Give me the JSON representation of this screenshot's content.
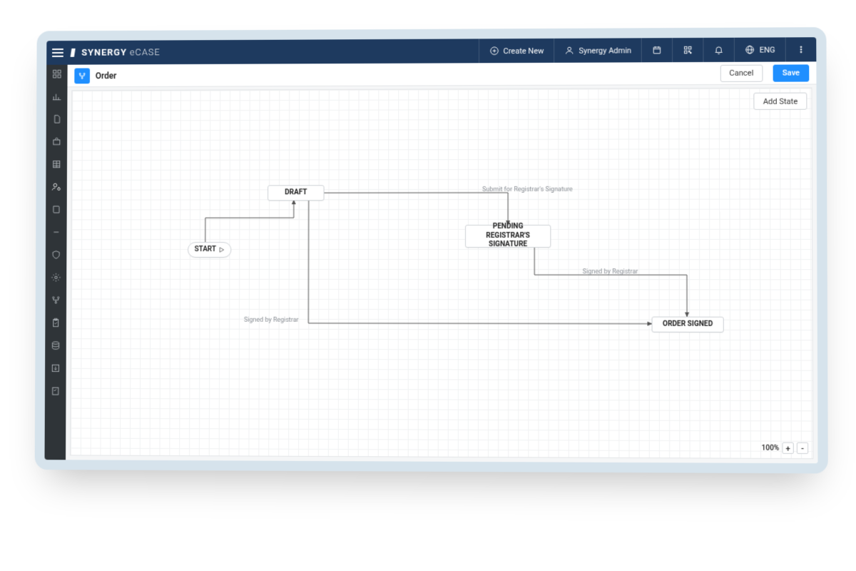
{
  "brand": {
    "strong": "SYNERGY",
    "light": "eCASE"
  },
  "topbar": {
    "create_new": "Create New",
    "user_name": "Synergy Admin",
    "lang": "ENG"
  },
  "sidebar_icons": [
    "dashboard",
    "chart",
    "document",
    "briefcase",
    "table",
    "user-settings",
    "book",
    "minus",
    "shield",
    "gear",
    "workflow",
    "clipboard",
    "database",
    "import",
    "checklist"
  ],
  "page": {
    "title": "Order",
    "cancel": "Cancel",
    "save": "Save",
    "add_state": "Add State"
  },
  "states": {
    "start": "START",
    "draft": "DRAFT",
    "pending": "PENDING REGISTRAR'S\nSIGNATURE",
    "signed": "ORDER SIGNED"
  },
  "transitions": {
    "submit": "Submit for Registrar's Signature",
    "signed_by_registrar_1": "Signed by Registrar",
    "signed_by_registrar_2": "Signed by Registrar"
  },
  "zoom": {
    "level": "100%",
    "plus": "+",
    "minus": "-"
  },
  "chart_data": {
    "type": "state-diagram",
    "title": "Order workflow",
    "nodes": [
      {
        "id": "start",
        "label": "START",
        "kind": "initial"
      },
      {
        "id": "draft",
        "label": "DRAFT",
        "kind": "state"
      },
      {
        "id": "pending",
        "label": "PENDING REGISTRAR'S SIGNATURE",
        "kind": "state"
      },
      {
        "id": "signed",
        "label": "ORDER SIGNED",
        "kind": "state"
      }
    ],
    "edges": [
      {
        "from": "start",
        "to": "draft",
        "label": ""
      },
      {
        "from": "draft",
        "to": "pending",
        "label": "Submit for Registrar's Signature"
      },
      {
        "from": "pending",
        "to": "signed",
        "label": "Signed by Registrar"
      },
      {
        "from": "draft",
        "to": "signed",
        "label": "Signed by Registrar"
      }
    ]
  }
}
